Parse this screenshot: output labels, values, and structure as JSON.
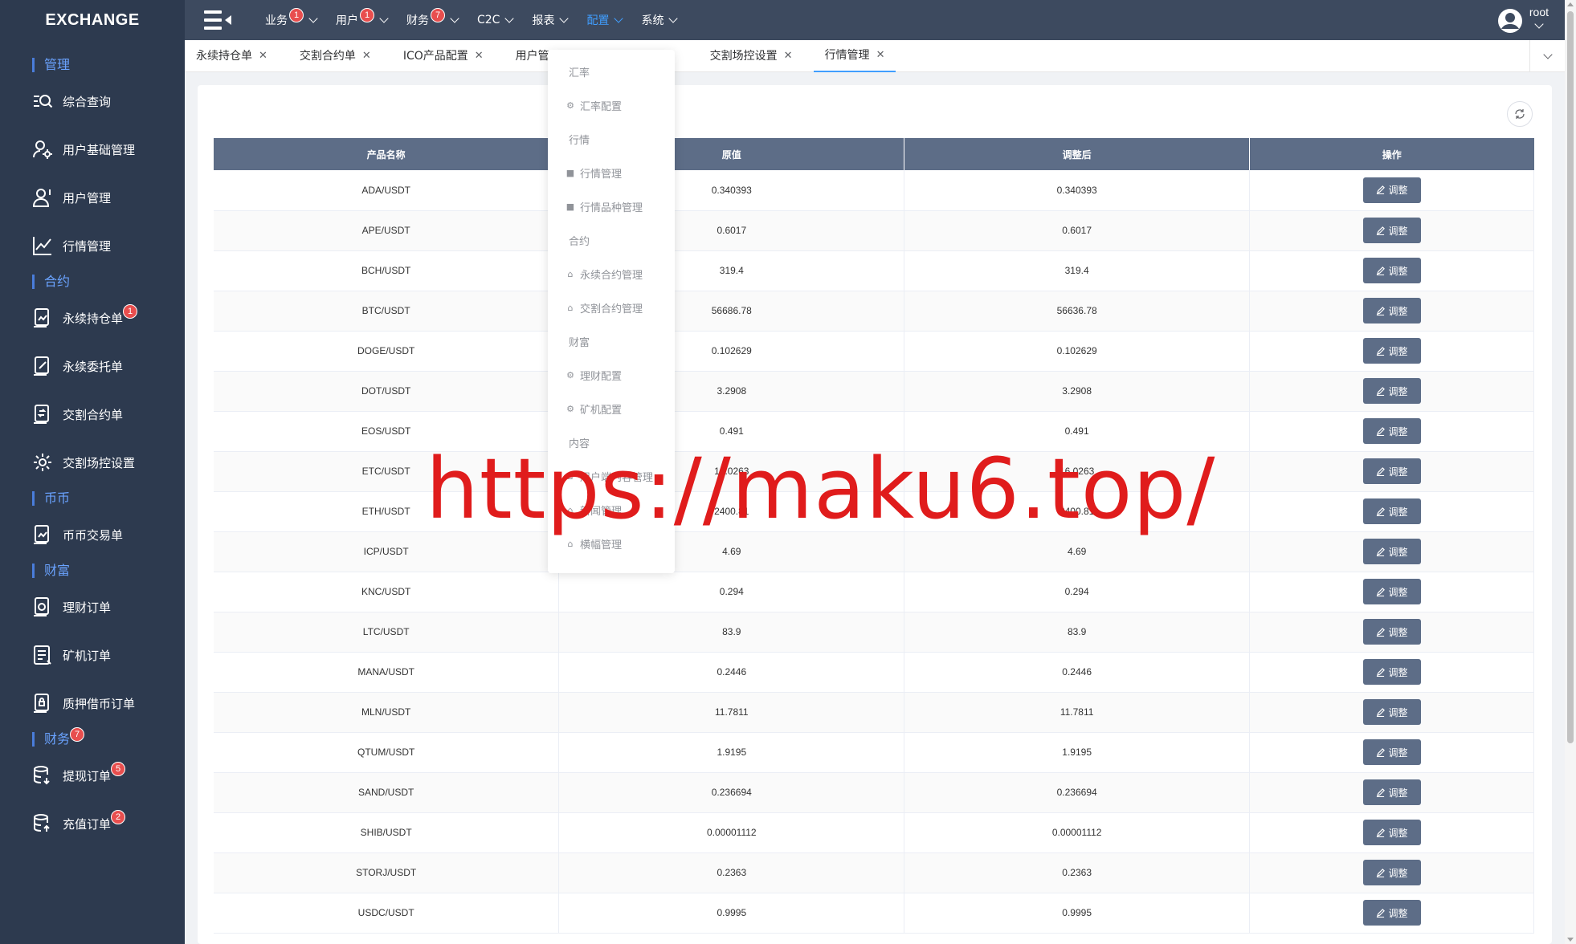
{
  "brand": "EXCHANGE",
  "sidebar": {
    "sections": [
      {
        "label": "管理"
      },
      {
        "label": "合约"
      },
      {
        "label": "币币"
      },
      {
        "label": "财富"
      },
      {
        "label": "财务",
        "badge": "7"
      }
    ],
    "items": [
      {
        "label": "综合查询"
      },
      {
        "label": "用户基础管理"
      },
      {
        "label": "用户管理"
      },
      {
        "label": "行情管理"
      },
      {
        "label": "永续持仓单",
        "badge": "1"
      },
      {
        "label": "永续委托单"
      },
      {
        "label": "交割合约单"
      },
      {
        "label": "交割场控设置"
      },
      {
        "label": "币币交易单"
      },
      {
        "label": "理财订单"
      },
      {
        "label": "矿机订单"
      },
      {
        "label": "质押借币订单"
      },
      {
        "label": "提现订单",
        "badge": "5"
      },
      {
        "label": "充值订单",
        "badge": "2"
      }
    ]
  },
  "topmenu": [
    {
      "label": "业务",
      "badge": "1"
    },
    {
      "label": "用户",
      "badge": "1"
    },
    {
      "label": "财务",
      "badge": "7"
    },
    {
      "label": "C2C"
    },
    {
      "label": "报表"
    },
    {
      "label": "配置"
    },
    {
      "label": "系统"
    }
  ],
  "user": {
    "name": "root"
  },
  "tabs": [
    {
      "label": "永续持仓单"
    },
    {
      "label": "交割合约单"
    },
    {
      "label": "ICO产品配置"
    },
    {
      "label": "用户管"
    },
    {
      "label": "交割场控设置"
    },
    {
      "label": "行情管理"
    }
  ],
  "table": {
    "headers": [
      "产品名称",
      "原值",
      "调整后",
      "操作"
    ],
    "action_label": "调整",
    "rows": [
      [
        "ADA/USDT",
        "0.340393",
        "0.340393"
      ],
      [
        "APE/USDT",
        "0.6017",
        "0.6017"
      ],
      [
        "BCH/USDT",
        "319.4",
        "319.4"
      ],
      [
        "BTC/USDT",
        "56686.78",
        "56636.78"
      ],
      [
        "DOGE/USDT",
        "0.102629",
        "0.102629"
      ],
      [
        "DOT/USDT",
        "3.2908",
        "3.2908"
      ],
      [
        "EOS/USDT",
        "0.491",
        "0.491"
      ],
      [
        "ETC/USDT",
        "16.0263",
        "16.0263"
      ],
      [
        "ETH/USDT",
        "2400.81",
        "2400.81"
      ],
      [
        "ICP/USDT",
        "4.69",
        "4.69"
      ],
      [
        "KNC/USDT",
        "0.294",
        "0.294"
      ],
      [
        "LTC/USDT",
        "83.9",
        "83.9"
      ],
      [
        "MANA/USDT",
        "0.2446",
        "0.2446"
      ],
      [
        "MLN/USDT",
        "11.7811",
        "11.7811"
      ],
      [
        "QTUM/USDT",
        "1.9195",
        "1.9195"
      ],
      [
        "SAND/USDT",
        "0.236694",
        "0.236694"
      ],
      [
        "SHIB/USDT",
        "0.00001112",
        "0.00001112"
      ],
      [
        "STORJ/USDT",
        "0.2363",
        "0.2363"
      ],
      [
        "USDC/USDT",
        "0.9995",
        "0.9995"
      ]
    ]
  },
  "dropdown": {
    "entries": [
      {
        "type": "group",
        "label": "汇率"
      },
      {
        "type": "item",
        "label": "汇率配置",
        "icon": "gear-icon"
      },
      {
        "type": "group",
        "label": "行情"
      },
      {
        "type": "item",
        "label": "行情管理",
        "icon": "square-icon"
      },
      {
        "type": "item",
        "label": "行情品种管理",
        "icon": "square-icon"
      },
      {
        "type": "group",
        "label": "合约"
      },
      {
        "type": "item",
        "label": "永续合约管理",
        "icon": "box-icon"
      },
      {
        "type": "item",
        "label": "交割合约管理",
        "icon": "box-icon"
      },
      {
        "type": "group",
        "label": "财富"
      },
      {
        "type": "item",
        "label": "理财配置",
        "icon": "gear-icon"
      },
      {
        "type": "item",
        "label": "矿机配置",
        "icon": "gear-icon"
      },
      {
        "type": "group",
        "label": "内容"
      },
      {
        "type": "item",
        "label": "用户端内容管理",
        "icon": "box-icon"
      },
      {
        "type": "item",
        "label": "新闻管理",
        "icon": "box-icon"
      },
      {
        "type": "item",
        "label": "横幅管理",
        "icon": "box-icon"
      }
    ]
  },
  "watermark": "https://maku6.top/",
  "colors": {
    "sidebar": "#2d3a4f",
    "topbar": "#3d4a5f",
    "table_header": "#5d6d87",
    "accent": "#409eff",
    "badge": "#e84e4e",
    "watermark": "#e01c1c"
  }
}
